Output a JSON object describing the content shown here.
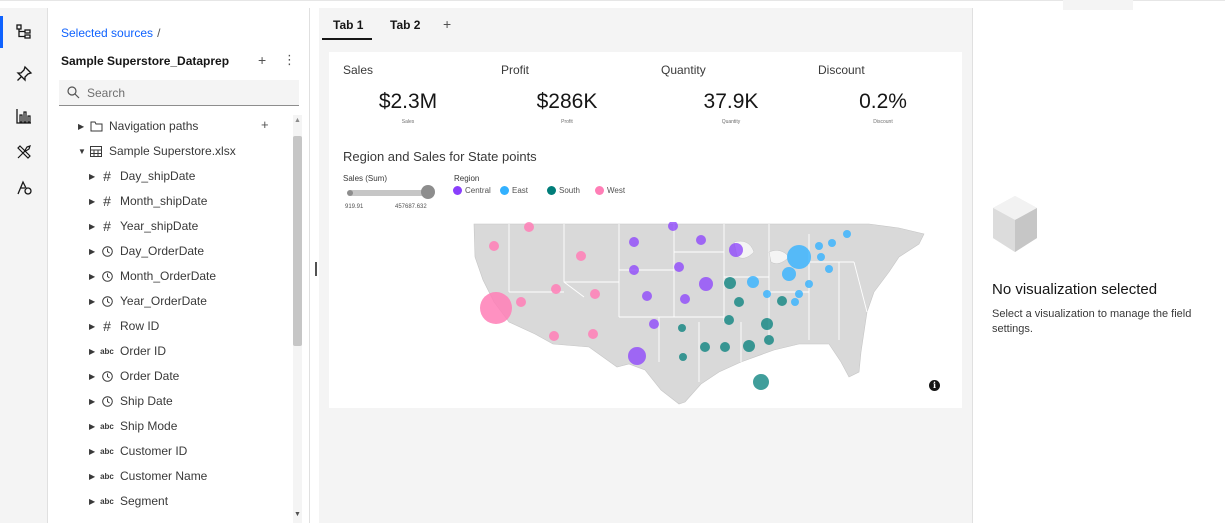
{
  "sidebar": {
    "breadcrumb": "Selected sources",
    "breadcrumb_sep": "/",
    "source_name": "Sample Superstore_Dataprep",
    "source_add": "+",
    "source_menu": "⋮",
    "search_placeholder": "Search",
    "tree": [
      {
        "label": "Navigation paths",
        "icon": "folder-icon",
        "expand": "collapsed"
      },
      {
        "label": "Sample Superstore.xlsx",
        "icon": "table-icon",
        "expand": "expanded"
      },
      {
        "label": "Day_shipDate",
        "icon": "numeric-icon",
        "expand": "collapsed"
      },
      {
        "label": "Month_shipDate",
        "icon": "numeric-icon",
        "expand": "collapsed"
      },
      {
        "label": "Year_shipDate",
        "icon": "numeric-icon",
        "expand": "collapsed"
      },
      {
        "label": "Day_OrderDate",
        "icon": "clock-icon",
        "expand": "collapsed"
      },
      {
        "label": "Month_OrderDate",
        "icon": "clock-icon",
        "expand": "collapsed"
      },
      {
        "label": "Year_OrderDate",
        "icon": "clock-icon",
        "expand": "collapsed"
      },
      {
        "label": "Row ID",
        "icon": "numeric-icon",
        "expand": "collapsed"
      },
      {
        "label": "Order ID",
        "icon": "text-icon",
        "expand": "collapsed"
      },
      {
        "label": "Order Date",
        "icon": "clock-icon",
        "expand": "collapsed"
      },
      {
        "label": "Ship Date",
        "icon": "clock-icon",
        "expand": "collapsed"
      },
      {
        "label": "Ship Mode",
        "icon": "text-icon",
        "expand": "collapsed"
      },
      {
        "label": "Customer ID",
        "icon": "text-icon",
        "expand": "collapsed"
      },
      {
        "label": "Customer Name",
        "icon": "text-icon",
        "expand": "collapsed"
      },
      {
        "label": "Segment",
        "icon": "text-icon",
        "expand": "collapsed"
      }
    ],
    "nav_add": "+"
  },
  "tabs": [
    {
      "label": "Tab 1",
      "active": true
    },
    {
      "label": "Tab 2",
      "active": false
    }
  ],
  "tab_add": "+",
  "kpis": [
    {
      "label": "Sales",
      "value": "$2.3M",
      "sub": "Sales"
    },
    {
      "label": "Profit",
      "value": "$286K",
      "sub": "Profit"
    },
    {
      "label": "Quantity",
      "value": "37.9K",
      "sub": "Quantity"
    },
    {
      "label": "Discount",
      "value": "0.2%",
      "sub": "Discount"
    }
  ],
  "viz": {
    "title": "Region and Sales for State points",
    "size_legend_title": "Sales (Sum)",
    "size_min": "919.91",
    "size_max": "457687.632",
    "color_legend_title": "Region",
    "regions": [
      {
        "name": "Central",
        "color": "#8a3ffc"
      },
      {
        "name": "East",
        "color": "#33b1ff"
      },
      {
        "name": "South",
        "color": "#007d79"
      },
      {
        "name": "West",
        "color": "#ff7eb6"
      }
    ],
    "info_glyph": "i"
  },
  "properties": {
    "empty_title": "No visualization selected",
    "empty_desc": "Select a visualization to manage the field settings."
  },
  "colors": {
    "accent": "#0f62fe",
    "map_land": "#d9d9d9",
    "map_border": "#ffffff"
  }
}
